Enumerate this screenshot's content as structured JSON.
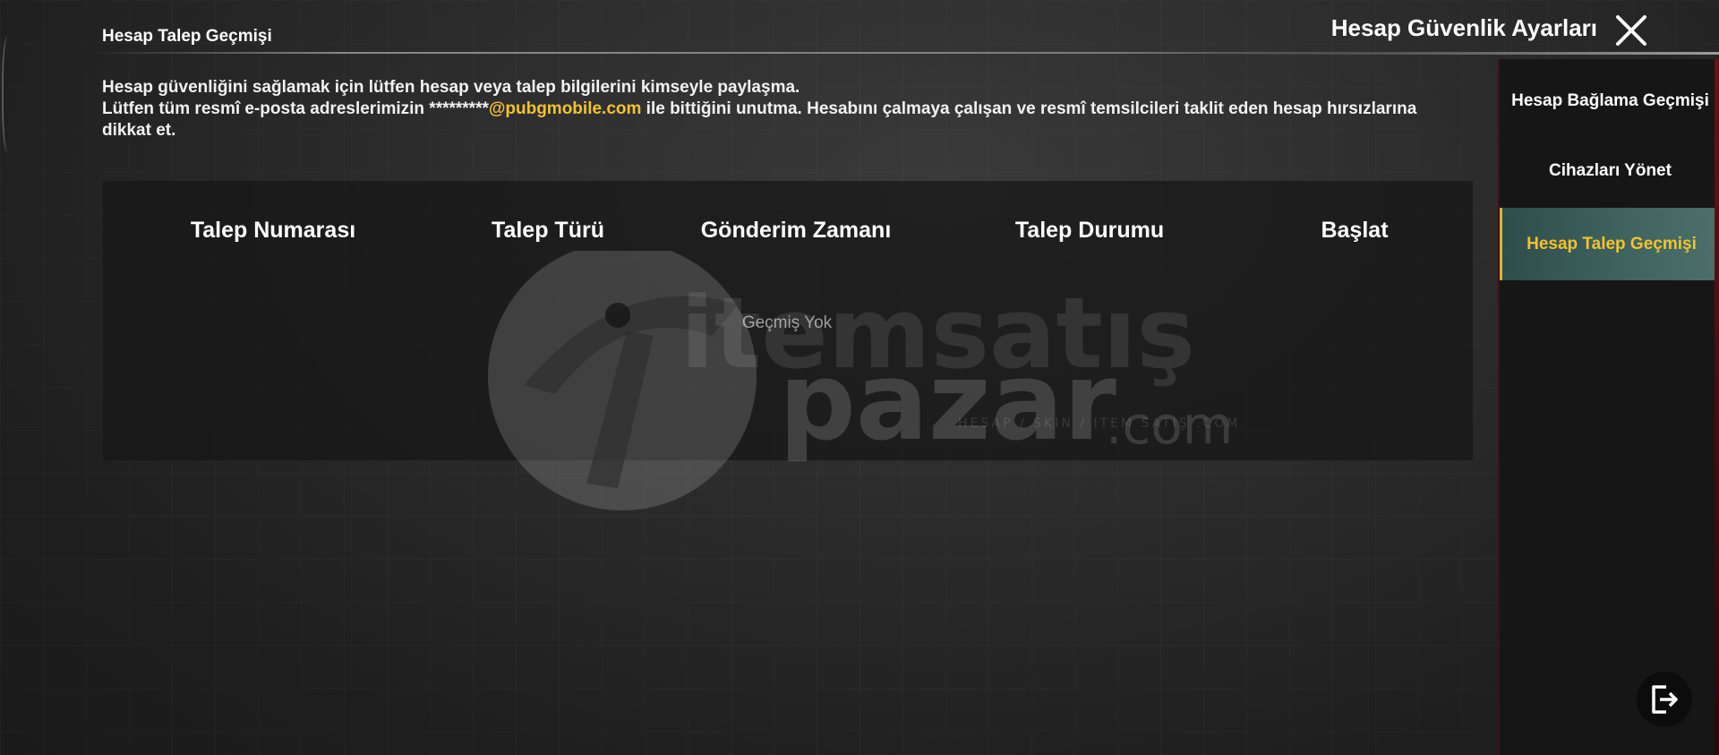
{
  "header": {
    "section_title": "Hesap Talep Geçmişi",
    "page_title": "Hesap Güvenlik Ayarları"
  },
  "notice": {
    "line1": "Hesap güvenliğini sağlamak için lütfen hesap veya talep bilgilerini kimseyle paylaşma.",
    "line2_before": "Lütfen tüm resmî e-posta adreslerimizin *********",
    "line2_domain": "@pubgmobile.com",
    "line2_after": " ile bittiğini unutma. Hesabını çalmaya çalışan ve resmî temsilcileri taklit eden hesap hırsızlarına dikkat et."
  },
  "table": {
    "columns": [
      "Talep Numarası",
      "Talep Türü",
      "Gönderim Zamanı",
      "Talep Durumu",
      "Başlat"
    ],
    "rows": [],
    "empty_text": "Geçmiş Yok"
  },
  "sidebar": {
    "items": [
      {
        "label": "Hesap Bağlama Geçmişi",
        "active": false
      },
      {
        "label": "Cihazları Yönet",
        "active": false
      },
      {
        "label": "Hesap Talep Geçmişi",
        "active": true
      }
    ]
  },
  "watermark": {
    "brand_top": "itemsatış",
    "brand_main": "pazar",
    "brand_suffix": ".com",
    "tagline": "HESAP / SKIN / ITEM SATIŞ .COM"
  },
  "icons": {
    "close": "close-icon",
    "logout": "logout-icon"
  },
  "colors": {
    "accent": "#f2c22e",
    "active_tab": "#406560",
    "panel": "#161616"
  }
}
